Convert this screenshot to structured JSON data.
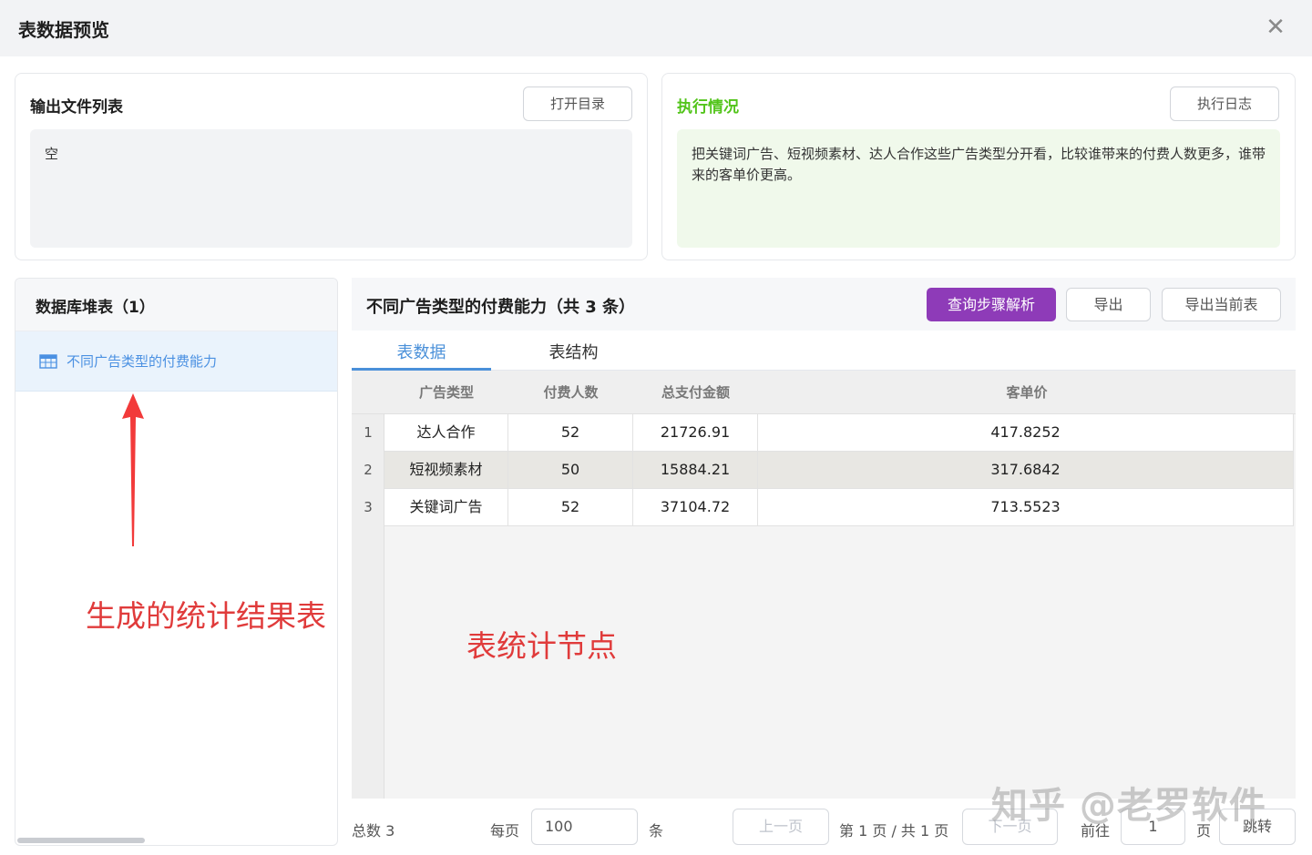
{
  "dialog": {
    "title": "表数据预览",
    "close_icon": "close-icon"
  },
  "output_files": {
    "header": "输出文件列表",
    "open_dir_label": "打开目录",
    "content": "空"
  },
  "execution": {
    "header": "执行情况",
    "log_label": "执行日志",
    "content": "把关键词广告、短视频素材、达人合作这些广告类型分开看，比较谁带来的付费人数更多，谁带来的客单价更高。",
    "header_color": "#52c41a",
    "box_color": "#f0f9eb"
  },
  "stack": {
    "header": "数据库堆表（1）",
    "items": [
      {
        "label": "不同广告类型的付费能力",
        "icon": "table-icon"
      }
    ]
  },
  "table_panel": {
    "title": "不同广告类型的付费能力（共 3 条）",
    "query_steps_label": "查询步骤解析",
    "export_label": "导出",
    "export_current_label": "导出当前表",
    "accent_color": "#8e3bb8"
  },
  "tabs": [
    {
      "label": "表数据",
      "active": true
    },
    {
      "label": "表结构",
      "active": false
    }
  ],
  "grid": {
    "columns": [
      "广告类型",
      "付费人数",
      "总支付金额",
      "客单价"
    ],
    "rows": [
      {
        "num": "1",
        "cells": [
          "达人合作",
          "52",
          "21726.91",
          "417.8252"
        ]
      },
      {
        "num": "2",
        "cells": [
          "短视频素材",
          "50",
          "15884.21",
          "317.6842"
        ]
      },
      {
        "num": "3",
        "cells": [
          "关键词广告",
          "52",
          "37104.72",
          "713.5523"
        ]
      }
    ]
  },
  "pagination": {
    "total_label": "总数 3",
    "per_page_label": "每页",
    "per_page_value": "100",
    "unit_label": "条",
    "prev_label": "上一页",
    "page_info": "第 1 页 / 共 1 页",
    "next_label": "下一页",
    "goto_label": "前往",
    "goto_value": "1",
    "page_unit": "页",
    "jump_label": "跳转"
  },
  "annotations": {
    "left": "生成的统计结果表",
    "right": "表统计节点",
    "color": "#e03b3b"
  },
  "watermark": "知乎 @老罗软件"
}
